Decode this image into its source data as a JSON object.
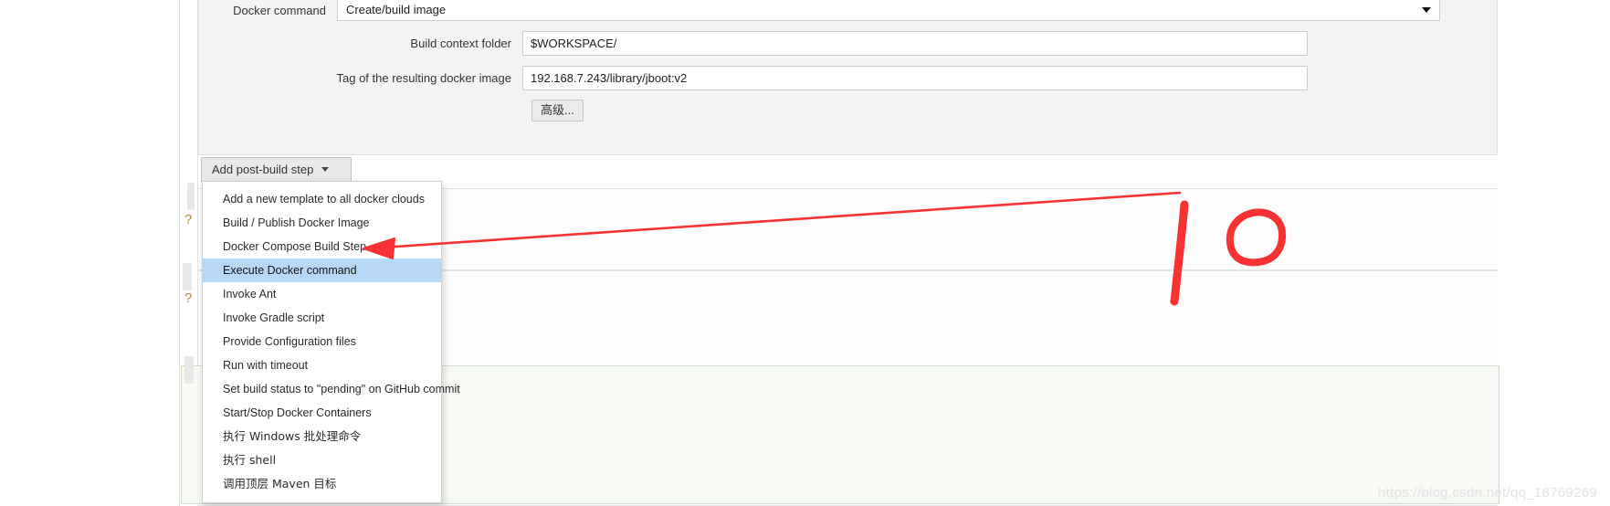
{
  "form": {
    "docker_command": {
      "label": "Docker command",
      "value": "Create/build image",
      "arrow_icon": "chevron-down-icon"
    },
    "build_context": {
      "label": "Build context folder",
      "value": "$WORKSPACE/"
    },
    "image_tag": {
      "label": "Tag of the resulting docker image",
      "value": "192.168.7.243/library/jboot:v2"
    },
    "advanced_button": "高级..."
  },
  "post_build": {
    "button_label": "Add post-build step",
    "caret_icon": "caret-down-icon",
    "menu_items": [
      {
        "label": "Add a new template to all docker clouds",
        "selected": false,
        "cjk": false
      },
      {
        "label": "Build / Publish Docker Image",
        "selected": false,
        "cjk": false
      },
      {
        "label": "Docker Compose Build Step",
        "selected": false,
        "cjk": false
      },
      {
        "label": "Execute Docker command",
        "selected": true,
        "cjk": false
      },
      {
        "label": "Invoke Ant",
        "selected": false,
        "cjk": false
      },
      {
        "label": "Invoke Gradle script",
        "selected": false,
        "cjk": false
      },
      {
        "label": "Provide Configuration files",
        "selected": false,
        "cjk": false
      },
      {
        "label": "Run with timeout",
        "selected": false,
        "cjk": false
      },
      {
        "label": "Set build status to \"pending\" on GitHub commit",
        "selected": false,
        "cjk": false
      },
      {
        "label": "Start/Stop Docker Containers",
        "selected": false,
        "cjk": false
      },
      {
        "label": "执行 Windows 批处理命令",
        "selected": false,
        "cjk": true
      },
      {
        "label": "执行 shell",
        "selected": false,
        "cjk": true
      },
      {
        "label": "调用顶层 Maven 目标",
        "selected": false,
        "cjk": true
      }
    ]
  },
  "annotations": {
    "color": "#f83232",
    "arrow_label": "arrow-pointing-to-execute-docker-command",
    "mark_one": "1",
    "mark_zero": "0"
  },
  "watermark": "https://blog.csdn.net/qq_18769269"
}
